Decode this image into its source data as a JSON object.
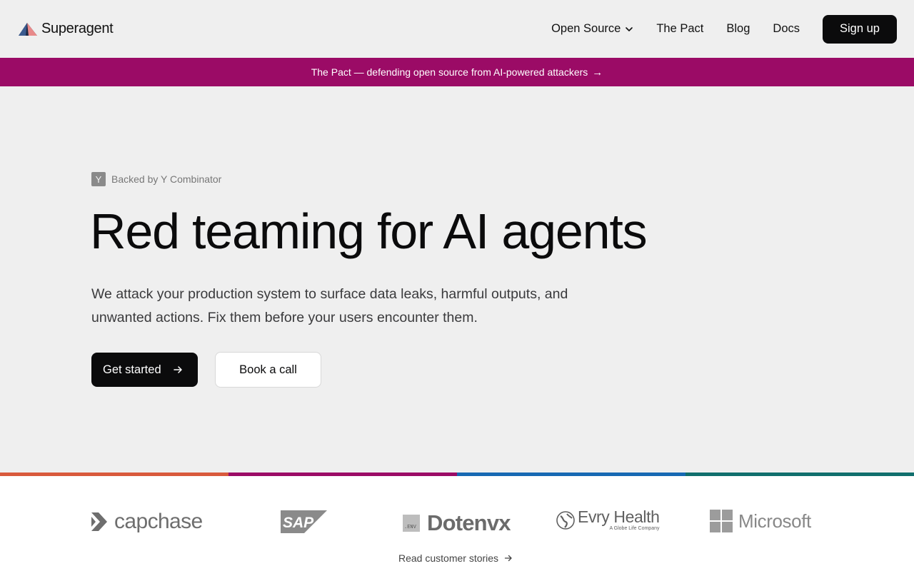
{
  "header": {
    "brand": "Superagent",
    "nav": [
      {
        "label": "Open Source",
        "has_dropdown": true
      },
      {
        "label": "The Pact",
        "has_dropdown": false
      },
      {
        "label": "Blog",
        "has_dropdown": false
      },
      {
        "label": "Docs",
        "has_dropdown": false
      }
    ],
    "signup_label": "Sign up"
  },
  "banner": {
    "text": "The Pact — defending open source from AI-powered attackers",
    "arrow": "→",
    "color": "#9b0b66"
  },
  "hero": {
    "badge_icon_letter": "Y",
    "badge_text": "Backed by Y Combinator",
    "title": "Red teaming for AI agents",
    "subtitle": "We attack your production system to surface data leaks, harmful outputs, and unwanted actions. Fix them before your users encounter them.",
    "primary_button": "Get started",
    "secondary_button": "Book a call"
  },
  "strip_colors": [
    "#d95a3c",
    "#9b0b66",
    "#1769b3",
    "#116f6d"
  ],
  "logos": {
    "capchase": "capchase",
    "sap": "SAP",
    "dotenvx_box": ".ENV",
    "dotenvx": "Dotenvx",
    "evry": "Evry Health",
    "evry_tag": "A Globe Life Company",
    "microsoft": "Microsoft",
    "stories_link": "Read customer stories"
  }
}
